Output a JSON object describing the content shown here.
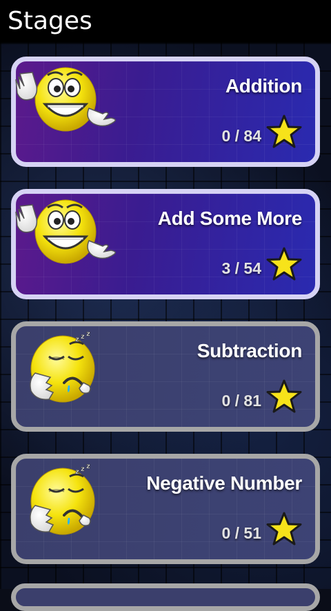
{
  "header": {
    "title": "Stages"
  },
  "stages": [
    {
      "title": "Addition",
      "progress": "0 / 84",
      "state": "unlocked",
      "mascot": "happy-waving-emoji-icon"
    },
    {
      "title": "Add Some More",
      "progress": "3 / 54",
      "state": "unlocked",
      "mascot": "happy-waving-emoji-icon"
    },
    {
      "title": "Subtraction",
      "progress": "0 / 81",
      "state": "locked",
      "mascot": "sleepy-emoji-icon"
    },
    {
      "title": "Negative Number",
      "progress": "0 / 51",
      "state": "locked",
      "mascot": "sleepy-emoji-icon"
    }
  ],
  "colors": {
    "star": "#f7e31a",
    "unlocked_border": "#d6d3f4",
    "locked_border": "#a7a7a7"
  }
}
